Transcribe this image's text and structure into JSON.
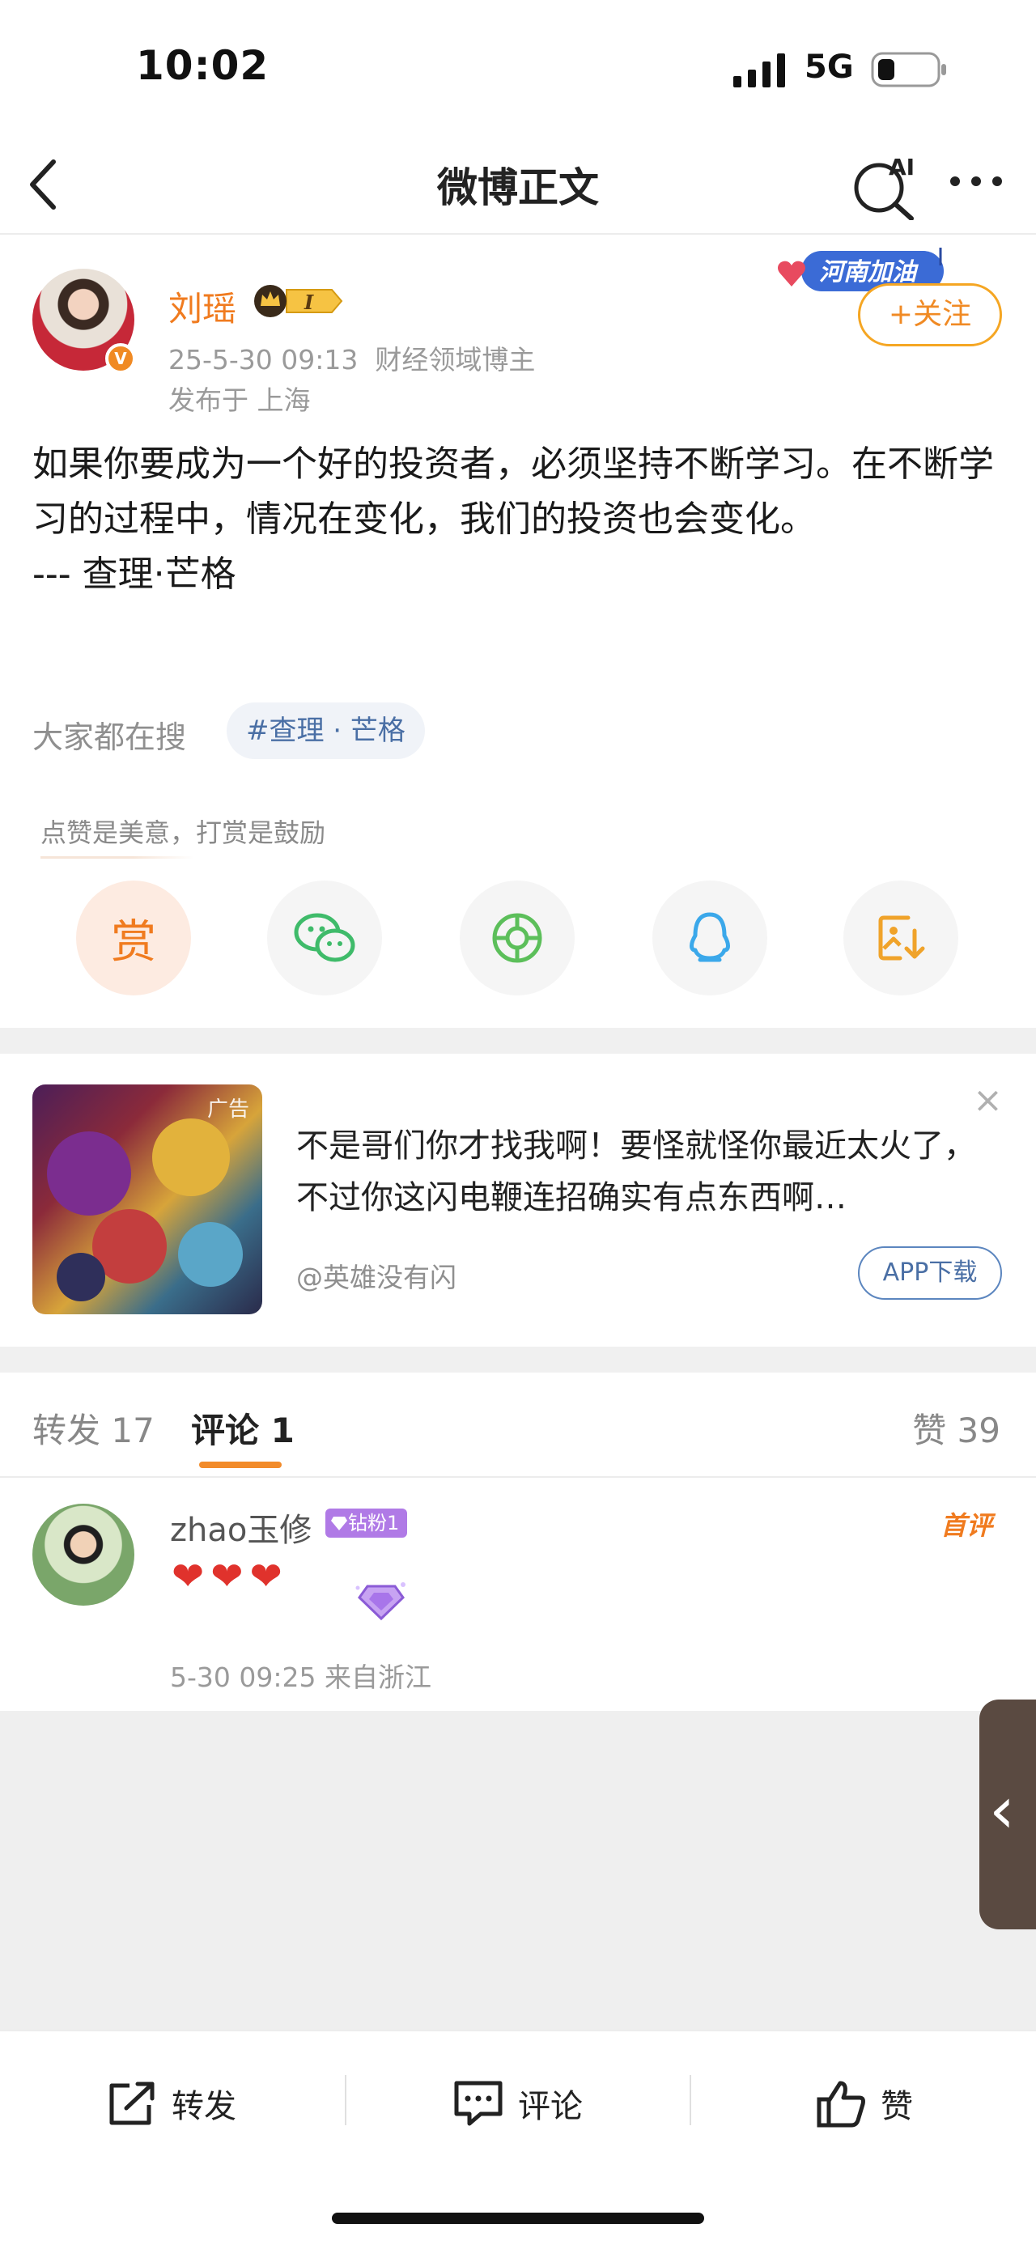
{
  "status_bar": {
    "time": "10:02",
    "network": "5G"
  },
  "nav": {
    "title": "微博正文",
    "ai_label": "AI"
  },
  "author": {
    "name": "刘瑶",
    "badge_level": "I",
    "time": "25-5-30 09:13",
    "title": "财经领域博主",
    "location": "发布于 上海",
    "follow_label": "+关注",
    "sticker_text": "河南加油"
  },
  "post": {
    "text": "如果你要成为一个好的投资者，必须坚持不断学习。在不断学习的过程中，情况在变化，我们的投资也会变化。\n--- 查理·芒格"
  },
  "search": {
    "label": "大家都在搜",
    "hashtag": "#查理 · 芒格"
  },
  "share": {
    "hint": "点赞是美意，打赏是鼓励",
    "reward_label": "赏",
    "icons": [
      "reward-icon",
      "wechat-icon",
      "moments-icon",
      "qq-icon",
      "save-image-icon"
    ]
  },
  "ad": {
    "image_label": "广告",
    "text": "不是哥们你才找我啊！要怪就怪你最近太火了，不过你这闪电鞭连招确实有点东西啊…",
    "source": "@英雄没有闪",
    "download_label": "APP下载"
  },
  "tabs": {
    "repost": "转发 17",
    "comment": "评论 1",
    "like": "赞 39"
  },
  "comment": {
    "user": "zhao玉修",
    "fan_badge": "钻粉1",
    "first_label": "首评",
    "hearts": "❤❤❤",
    "meta": "5-30 09:25 来自浙江"
  },
  "bottom_bar": {
    "repost": "转发",
    "comment": "评论",
    "like": "赞"
  },
  "colors": {
    "accent": "#f07b1f",
    "link": "#4a6fa5",
    "heart": "#e0322c"
  }
}
